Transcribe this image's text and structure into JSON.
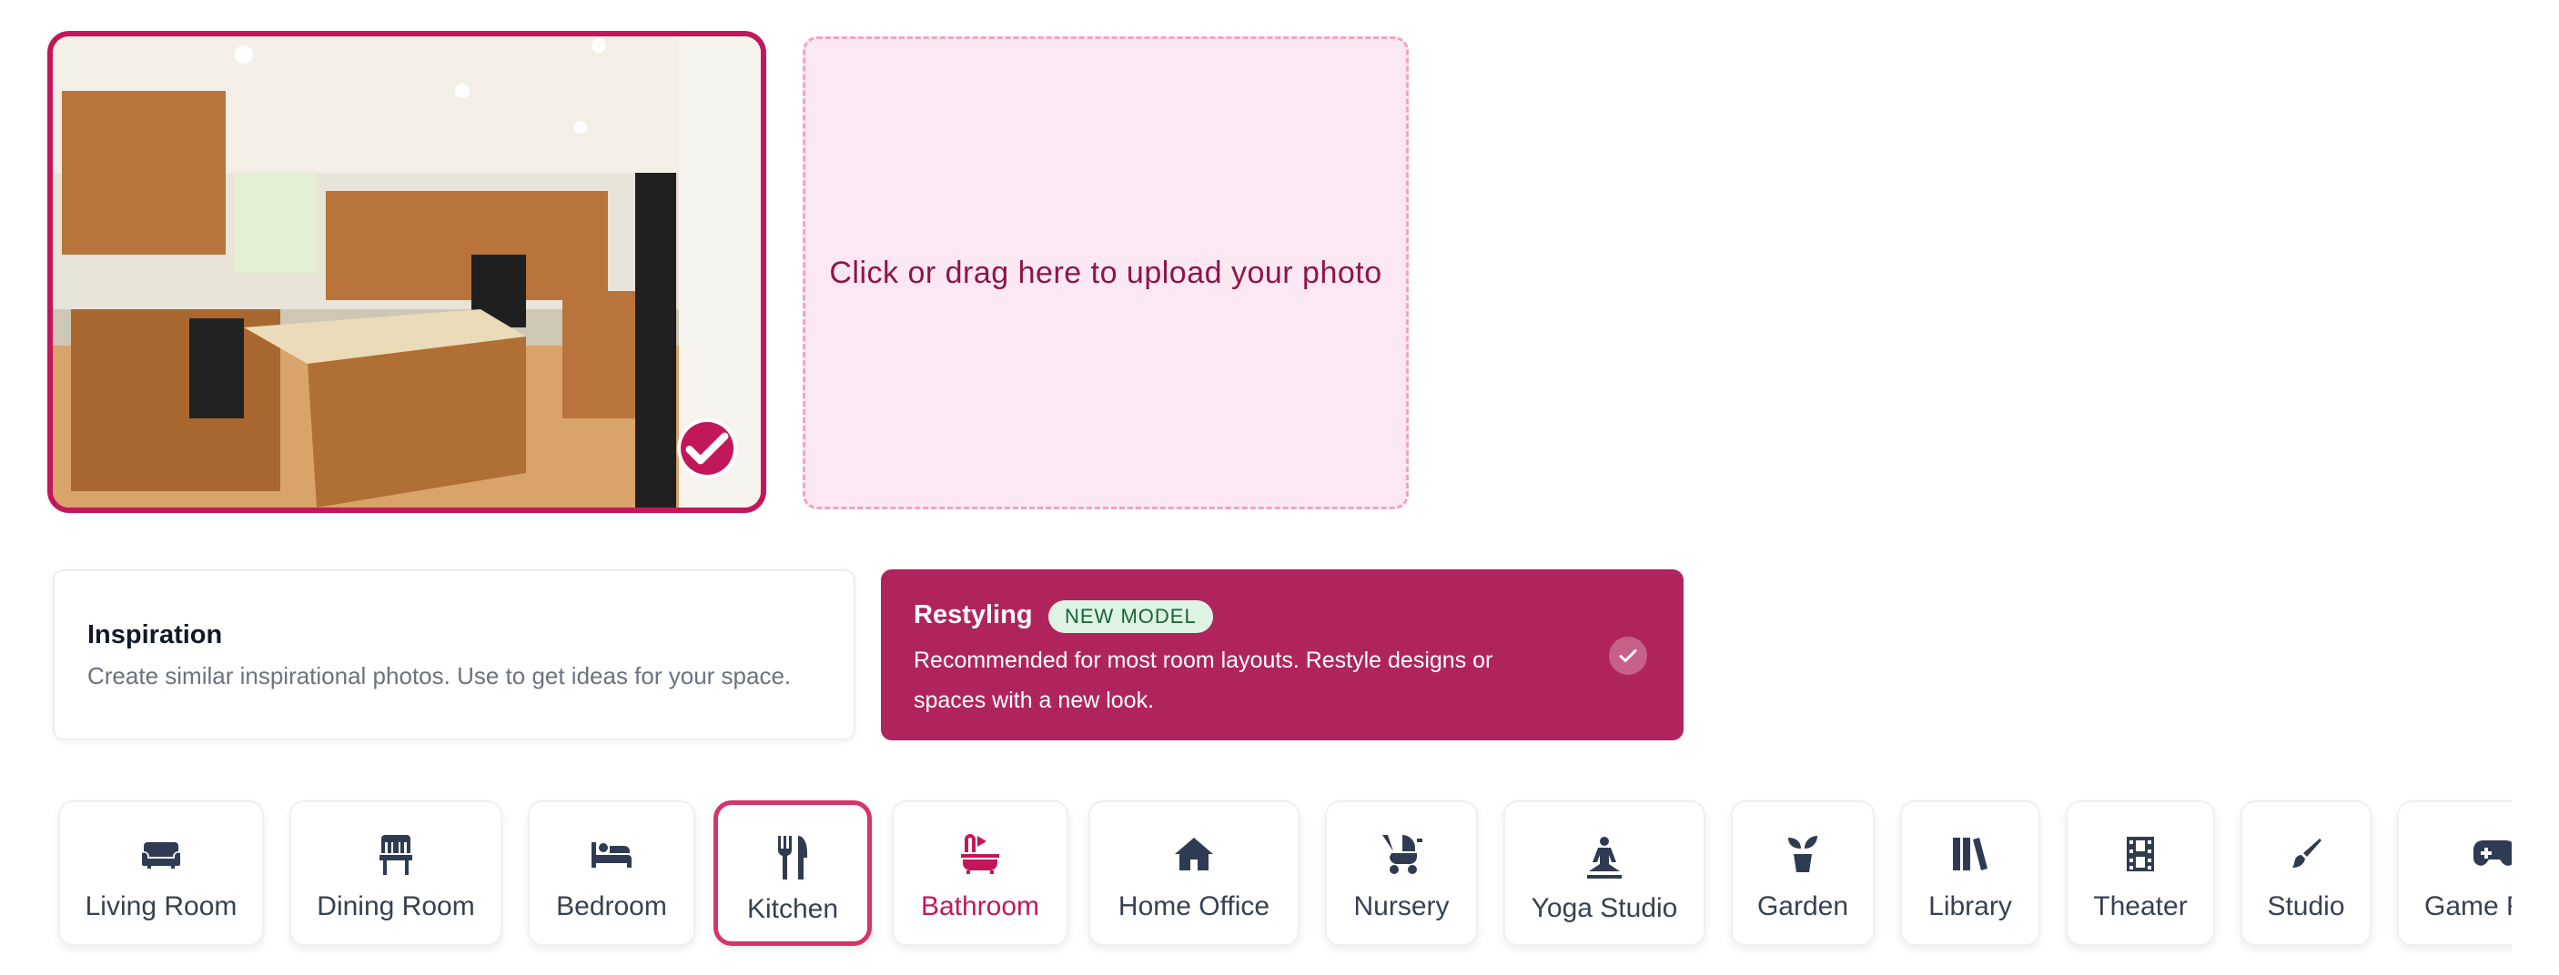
{
  "upload": {
    "prompt": "Click or drag here to upload your photo"
  },
  "modes": {
    "inspiration": {
      "title": "Inspiration",
      "description": "Create similar inspirational photos. Use to get ideas for your space.",
      "selected": false
    },
    "restyling": {
      "title": "Restyling",
      "badge": "NEW MODEL",
      "description": "Recommended for most room layouts. Restyle designs or spaces with a new look.",
      "selected": true
    }
  },
  "room_types": [
    {
      "label": "Living Room",
      "icon": "sofa-icon"
    },
    {
      "label": "Dining Room",
      "icon": "chair-icon"
    },
    {
      "label": "Bedroom",
      "icon": "bed-icon"
    },
    {
      "label": "Kitchen",
      "icon": "utensils-icon",
      "selected": true
    },
    {
      "label": "Bathroom",
      "icon": "bathtub-icon"
    },
    {
      "label": "Home Office",
      "icon": "house-icon"
    },
    {
      "label": "Nursery",
      "icon": "stroller-icon"
    },
    {
      "label": "Yoga Studio",
      "icon": "yoga-pose-icon"
    },
    {
      "label": "Garden",
      "icon": "seedling-icon"
    },
    {
      "label": "Library",
      "icon": "books-icon"
    },
    {
      "label": "Theater",
      "icon": "film-icon"
    },
    {
      "label": "Studio",
      "icon": "paintbrush-icon"
    },
    {
      "label": "Game Room",
      "icon": "gamepad-icon"
    }
  ],
  "colors": {
    "accent": "#c2185b",
    "restyle_card": "#b0245d",
    "upload_bg": "#fbe8f2",
    "badge_bg": "#dff3e4",
    "icon": "#2f3b52"
  }
}
